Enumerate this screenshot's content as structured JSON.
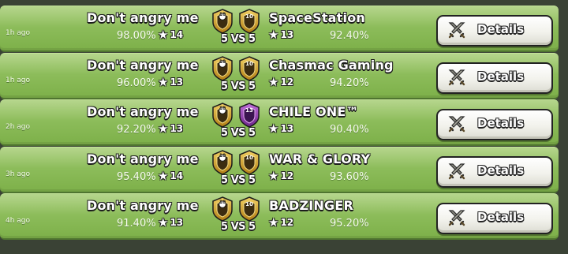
{
  "war_log": [
    {
      "time_ago": "1h ago",
      "my_clan": {
        "name": "Don't angry me",
        "destruction": "98.00%",
        "stars": "14",
        "badge_level": "10"
      },
      "opponent": {
        "name": "SpaceStation",
        "destruction": "92.40%",
        "stars": "13",
        "badge_level": "10"
      },
      "vs_text": "5 VS 5",
      "details_label": "Details"
    },
    {
      "time_ago": "1h ago",
      "my_clan": {
        "name": "Don't angry me",
        "destruction": "96.00%",
        "stars": "13",
        "badge_level": "10"
      },
      "opponent": {
        "name": "Chasmac Gaming",
        "destruction": "94.20%",
        "stars": "12",
        "badge_level": "10"
      },
      "vs_text": "5 VS 5",
      "details_label": "Details"
    },
    {
      "time_ago": "2h ago",
      "my_clan": {
        "name": "Don't angry me",
        "destruction": "92.20%",
        "stars": "13",
        "badge_level": "10"
      },
      "opponent": {
        "name": "CHILE ONE™",
        "destruction": "90.40%",
        "stars": "13",
        "badge_level": "13"
      },
      "vs_text": "5 VS 5",
      "details_label": "Details"
    },
    {
      "time_ago": "3h ago",
      "my_clan": {
        "name": "Don't angry me",
        "destruction": "95.40%",
        "stars": "14",
        "badge_level": "10"
      },
      "opponent": {
        "name": "WAR & GLORY",
        "destruction": "93.60%",
        "stars": "12",
        "badge_level": "10"
      },
      "vs_text": "5 VS 5",
      "details_label": "Details"
    },
    {
      "time_ago": "4h ago",
      "my_clan": {
        "name": "Don't angry me",
        "destruction": "91.40%",
        "stars": "13",
        "badge_level": "10"
      },
      "opponent": {
        "name": "BADZINGER",
        "destruction": "95.20%",
        "stars": "12",
        "badge_level": "10"
      },
      "vs_text": "5 VS 5",
      "details_label": "Details"
    }
  ],
  "icons": {
    "star": "star-icon",
    "badge": "clan-badge-icon",
    "details": "crossed-swords-icon"
  },
  "colors": {
    "row_green": "#8cbc5a",
    "badge_gold": "#d4a52a",
    "badge_purple": "#8b3fa8",
    "badge_dark": "#2a2a2a"
  }
}
